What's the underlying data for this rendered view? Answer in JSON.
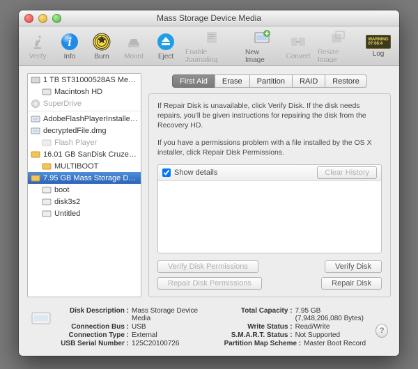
{
  "window_title": "Mass Storage Device Media",
  "toolbar": {
    "verify": "Verify",
    "info": "Info",
    "burn": "Burn",
    "mount": "Mount",
    "eject": "Eject",
    "enable_journaling": "Enable Journaling",
    "new_image": "New Image",
    "convert": "Convert",
    "resize_image": "Resize Image",
    "log": "Log"
  },
  "sidebar": {
    "items": [
      {
        "label": "1 TB ST31000528AS Media",
        "kind": "disk"
      },
      {
        "label": "Macintosh HD",
        "kind": "vol"
      },
      {
        "label": "SuperDrive",
        "kind": "optical",
        "dim": true
      },
      {
        "label": "AdobeFlashPlayerInstalle…",
        "kind": "dmg"
      },
      {
        "label": "decryptedFile.dmg",
        "kind": "dmg"
      },
      {
        "label": "Flash Player",
        "kind": "vol-dim",
        "dim": true
      },
      {
        "label": "16.01 GB SanDisk Cruze…",
        "kind": "disk-ext"
      },
      {
        "label": "MULTIBOOT",
        "kind": "vol-ext"
      },
      {
        "label": "7.95 GB Mass Storage D…",
        "kind": "disk-ext",
        "selected": true
      },
      {
        "label": "boot",
        "kind": "vol"
      },
      {
        "label": "disk3s2",
        "kind": "vol"
      },
      {
        "label": "Untitled",
        "kind": "vol"
      }
    ]
  },
  "tabs": {
    "first_aid": "First Aid",
    "erase": "Erase",
    "partition": "Partition",
    "raid": "RAID",
    "restore": "Restore"
  },
  "first_aid": {
    "p1": "If Repair Disk is unavailable, click Verify Disk. If the disk needs repairs, you'll be given instructions for repairing the disk from the Recovery HD.",
    "p2": "If you have a permissions problem with a file installed by the OS X installer, click Repair Disk Permissions.",
    "show_details": "Show details",
    "clear_history": "Clear History",
    "verify_perm": "Verify Disk Permissions",
    "repair_perm": "Repair Disk Permissions",
    "verify_disk": "Verify Disk",
    "repair_disk": "Repair Disk"
  },
  "footer": {
    "disk_description_k": "Disk Description :",
    "disk_description_v": "Mass Storage Device Media",
    "connection_bus_k": "Connection Bus :",
    "connection_bus_v": "USB",
    "connection_type_k": "Connection Type :",
    "connection_type_v": "External",
    "usb_serial_k": "USB Serial Number :",
    "usb_serial_v": "125C20100726",
    "total_capacity_k": "Total Capacity :",
    "total_capacity_v": "7.95 GB (7,948,206,080 Bytes)",
    "write_status_k": "Write Status :",
    "write_status_v": "Read/Write",
    "smart_status_k": "S.M.A.R.T. Status :",
    "smart_status_v": "Not Supported",
    "partition_scheme_k": "Partition Map Scheme :",
    "partition_scheme_v": "Master Boot Record"
  }
}
